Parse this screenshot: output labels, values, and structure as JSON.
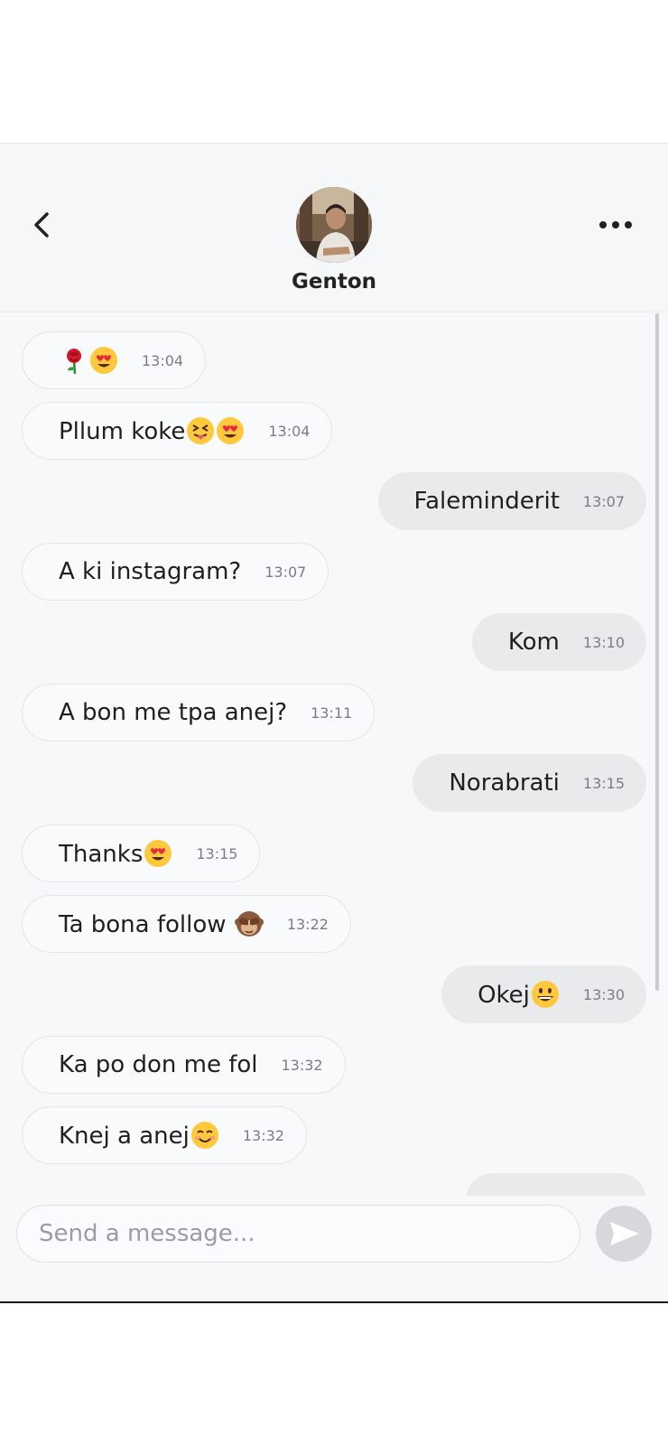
{
  "header": {
    "contact_name": "Genton"
  },
  "messages": [
    {
      "dir": "in",
      "text": "",
      "emojis": [
        "rose",
        "heart-eyes"
      ],
      "time": "13:04"
    },
    {
      "dir": "in",
      "text": "Pllum koke",
      "emojis": [
        "squinting-tongue",
        "heart-eyes"
      ],
      "time": "13:04"
    },
    {
      "dir": "out",
      "text": "Faleminderit",
      "emojis": [],
      "time": "13:07"
    },
    {
      "dir": "in",
      "text": "A ki instagram?",
      "emojis": [],
      "time": "13:07"
    },
    {
      "dir": "out",
      "text": "Kom",
      "emojis": [],
      "time": "13:10"
    },
    {
      "dir": "in",
      "text": "A bon me tpa anej?",
      "emojis": [],
      "time": "13:11"
    },
    {
      "dir": "out",
      "text": "Norabrati",
      "emojis": [],
      "time": "13:15"
    },
    {
      "dir": "in",
      "text": "Thanks",
      "emojis": [
        "heart-eyes"
      ],
      "time": "13:15"
    },
    {
      "dir": "in",
      "text": "Ta bona follow ",
      "emojis": [
        "see-no-evil-monkey"
      ],
      "time": "13:22"
    },
    {
      "dir": "out",
      "text": "Okej",
      "emojis": [
        "grinning-face"
      ],
      "time": "13:30"
    },
    {
      "dir": "in",
      "text": "Ka po don me fol",
      "emojis": [],
      "time": "13:32"
    },
    {
      "dir": "in",
      "text": "Knej a anej",
      "emojis": [
        "smiling-face"
      ],
      "time": "13:32"
    }
  ],
  "composer": {
    "placeholder": "Send a message..."
  },
  "colors": {
    "incoming_bubble": "#f9fafb",
    "outgoing_bubble": "#e9eaec",
    "send_button": "#d7d8db"
  }
}
